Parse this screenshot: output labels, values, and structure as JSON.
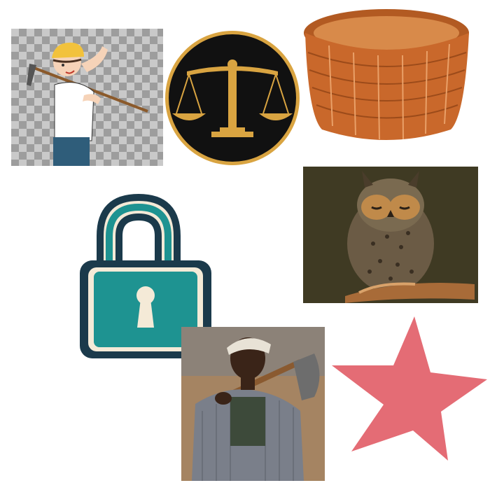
{
  "images": [
    {
      "name": "farmer-with-hoe"
    },
    {
      "name": "scales-of-justice"
    },
    {
      "name": "wicker-basket"
    },
    {
      "name": "padlock"
    },
    {
      "name": "owl"
    },
    {
      "name": "young-man-with-shovel"
    },
    {
      "name": "red-star"
    }
  ],
  "colors": {
    "farmer_skin": "#f6d3b8",
    "farmer_hat": "#f2c23c",
    "farmer_pants": "#2f5d7a",
    "scales_gold": "#d9a441",
    "scales_bg": "#111111",
    "basket": "#c9682b",
    "lock_teal": "#1e9391",
    "lock_outline": "#1b3a4b",
    "lock_cream": "#f4ead7",
    "owl_bg": "#3f3a23",
    "owl_feathers": "#6b5b45",
    "branch": "#a86b38",
    "star": "#e46c75"
  }
}
